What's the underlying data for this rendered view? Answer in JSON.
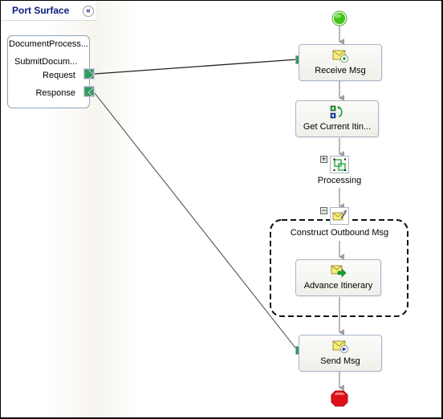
{
  "port_surface": {
    "title": "Port Surface",
    "collapse_glyph": "«",
    "port": {
      "name": "DocumentProcess...",
      "operation": "SubmitDocum...",
      "request_label": "Request",
      "response_label": "Response"
    }
  },
  "orchestration": {
    "start_shape": "start",
    "shapes": {
      "receive": {
        "label": "Receive Msg",
        "icon": "receive-message-icon"
      },
      "get_itinerary": {
        "label": "Get Current Itin...",
        "icon": "call-orchestration-icon"
      },
      "processing": {
        "label": "Processing",
        "icon": "group-icon",
        "toggle": "+"
      },
      "construct": {
        "label": "Construct Outbound Msg",
        "icon": "construct-message-icon",
        "toggle": "−"
      },
      "advance": {
        "label": "Advance Itinerary",
        "icon": "message-assignment-icon"
      },
      "send": {
        "label": "Send Msg",
        "icon": "send-message-icon"
      }
    },
    "end_shape": "stop"
  },
  "colors": {
    "port_green": "#2e9d5b",
    "title_blue": "#0b1d7a",
    "connector_gray": "#a0a0a0",
    "start_green": "#44c21c",
    "stop_red": "#e0101a"
  }
}
